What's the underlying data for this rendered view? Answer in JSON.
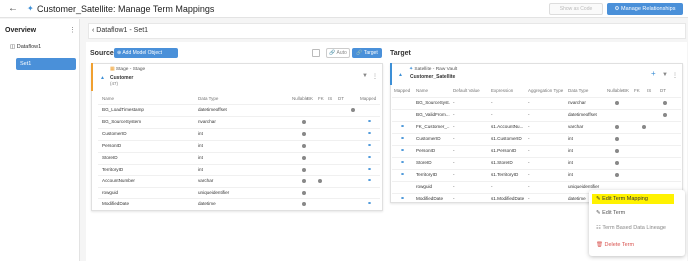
{
  "header": {
    "back_icon": "arrow-left-icon",
    "title": "Customer_Satellite: Manage Term Mappings",
    "disabled_button": "Show as Code",
    "primary_button": "Manage Relationships"
  },
  "overview": {
    "title": "Overview",
    "dataflow": "Dataflow1",
    "set": "Set1"
  },
  "breadcrumb": "Dataflow1 - Set1",
  "source": {
    "title": "Source",
    "add_button": "Add Model Object",
    "auto_label": "Auto",
    "target_label": "Target",
    "card": {
      "stage": "Stage - Stage",
      "name": "Customer",
      "count": "(47)",
      "headers": [
        "Name",
        "Data Type",
        "Nullable",
        "BK",
        "FK",
        "IS",
        "DT",
        "Mapped"
      ],
      "rows": [
        {
          "name": "BG_LoadTimestamp",
          "type": "datetimeoffset"
        },
        {
          "name": "BG_SourceSystem",
          "type": "nvarchar"
        },
        {
          "name": "CustomerID",
          "type": "int"
        },
        {
          "name": "PersonID",
          "type": "int"
        },
        {
          "name": "StoreID",
          "type": "int"
        },
        {
          "name": "TerritoryID",
          "type": "int"
        },
        {
          "name": "AccountNumber",
          "type": "varchar"
        },
        {
          "name": "rowguid",
          "type": "uniqueidentifier"
        },
        {
          "name": "ModifiedDate",
          "type": "datetime"
        }
      ]
    }
  },
  "target": {
    "title": "Target",
    "card": {
      "stage": "Satellite - Raw Vault",
      "name": "Customer_Satellite",
      "headers": [
        "Mapped",
        "Name",
        "Default Value",
        "Expression",
        "Aggregation Type",
        "Data Type",
        "Nullable",
        "BK",
        "FK",
        "IS",
        "DT"
      ],
      "rows": [
        {
          "name": "BG_SourceSyst...",
          "default": "-",
          "expr": "-",
          "agg": "-",
          "type": "nvarchar"
        },
        {
          "name": "BG_ValidFrom...",
          "default": "-",
          "expr": "-",
          "agg": "-",
          "type": "datetimeoffset"
        },
        {
          "name": "FK_Customer_...",
          "default": "-",
          "expr": "s1.AccountNu...",
          "agg": "-",
          "type": "varchar"
        },
        {
          "name": "CustomerID",
          "default": "-",
          "expr": "s1.CustomerID",
          "agg": "-",
          "type": "int"
        },
        {
          "name": "PersonID",
          "default": "-",
          "expr": "s1.PersonID",
          "agg": "-",
          "type": "int"
        },
        {
          "name": "StoreID",
          "default": "-",
          "expr": "s1.StoreID",
          "agg": "-",
          "type": "int"
        },
        {
          "name": "TerritoryID",
          "default": "-",
          "expr": "s1.TerritoryID",
          "agg": "-",
          "type": "int"
        },
        {
          "name": "rowguid",
          "default": "-",
          "expr": "-",
          "agg": "-",
          "type": "uniqueidentifier"
        },
        {
          "name": "ModifiedDate",
          "default": "-",
          "expr": "s1.ModifiedDate",
          "agg": "-",
          "type": "datetime"
        }
      ]
    }
  },
  "context_menu": {
    "items": [
      "Edit Term Mapping",
      "Edit Term",
      "Term Based Data Lineage",
      "Delete Term"
    ]
  },
  "colors": {
    "accent": "#4a90d9",
    "highlight": "#fff200",
    "delete": "#d9534f"
  }
}
